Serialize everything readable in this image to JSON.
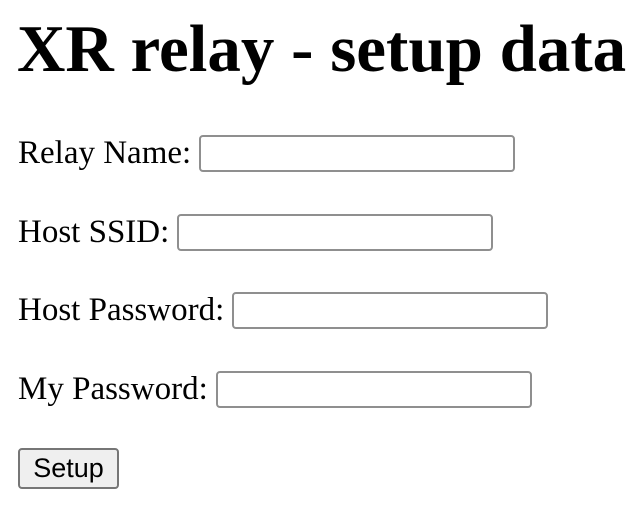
{
  "title": "XR relay - setup data",
  "fields": [
    {
      "label": "Relay Name:",
      "value": ""
    },
    {
      "label": "Host SSID:",
      "value": ""
    },
    {
      "label": "Host Password:",
      "value": ""
    },
    {
      "label": "My Password:",
      "value": ""
    }
  ],
  "submit_label": "Setup"
}
